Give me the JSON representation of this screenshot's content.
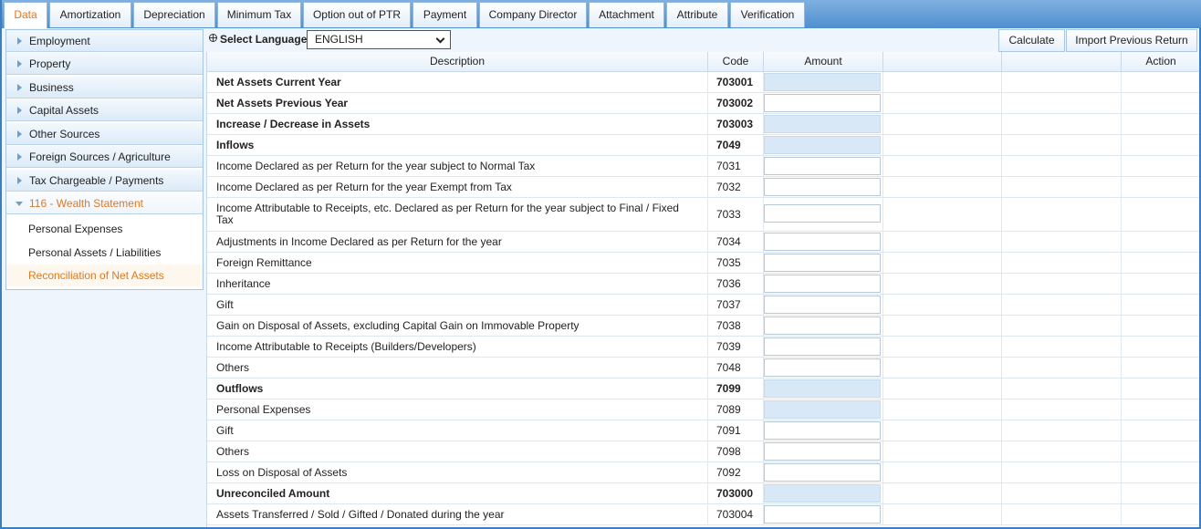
{
  "tabs": [
    {
      "label": "Data",
      "active": true
    },
    {
      "label": "Amortization"
    },
    {
      "label": "Depreciation"
    },
    {
      "label": "Minimum Tax"
    },
    {
      "label": "Option out of PTR"
    },
    {
      "label": "Payment"
    },
    {
      "label": "Company Director"
    },
    {
      "label": "Attachment"
    },
    {
      "label": "Attribute"
    },
    {
      "label": "Verification"
    }
  ],
  "sidebar": {
    "items": [
      {
        "label": "Employment"
      },
      {
        "label": "Property"
      },
      {
        "label": "Business"
      },
      {
        "label": "Capital Assets"
      },
      {
        "label": "Other Sources"
      },
      {
        "label": "Foreign Sources / Agriculture"
      },
      {
        "label": "Tax Chargeable / Payments"
      },
      {
        "label": "116 - Wealth Statement",
        "expanded": true
      }
    ],
    "subitems": [
      {
        "label": "Personal Expenses"
      },
      {
        "label": "Personal Assets / Liabilities"
      },
      {
        "label": "Reconciliation of Net Assets",
        "active": true
      }
    ]
  },
  "toolbar": {
    "language_label": "Select Language",
    "language_value": "ENGLISH",
    "calculate_label": "Calculate",
    "import_label": "Import Previous Return"
  },
  "grid": {
    "headers": {
      "description": "Description",
      "code": "Code",
      "amount": "Amount",
      "action": "Action"
    },
    "rows": [
      {
        "description": "Net Assets Current Year",
        "code": "703001",
        "bold": true,
        "readonly": true
      },
      {
        "description": "Net Assets Previous Year",
        "code": "703002",
        "bold": true,
        "readonly": false
      },
      {
        "description": "Increase / Decrease in Assets",
        "code": "703003",
        "bold": true,
        "readonly": true
      },
      {
        "description": "Inflows",
        "code": "7049",
        "bold": true,
        "readonly": true
      },
      {
        "description": "Income Declared as per Return for the year subject to Normal Tax",
        "code": "7031"
      },
      {
        "description": "Income Declared as per Return for the year Exempt from Tax",
        "code": "7032"
      },
      {
        "description": "Income Attributable to Receipts, etc. Declared as per Return for the year subject to Final / Fixed Tax",
        "code": "7033",
        "tall": true
      },
      {
        "description": "Adjustments in Income Declared as per Return for the year",
        "code": "7034"
      },
      {
        "description": "Foreign Remittance",
        "code": "7035"
      },
      {
        "description": "Inheritance",
        "code": "7036"
      },
      {
        "description": "Gift",
        "code": "7037"
      },
      {
        "description": "Gain on Disposal of Assets, excluding Capital Gain on Immovable Property",
        "code": "7038"
      },
      {
        "description": "Income Attributable to Receipts (Builders/Developers)",
        "code": "7039"
      },
      {
        "description": "Others",
        "code": "7048"
      },
      {
        "description": "Outflows",
        "code": "7099",
        "bold": true,
        "readonly": true
      },
      {
        "description": "Personal Expenses",
        "code": "7089",
        "readonly": true
      },
      {
        "description": "Gift",
        "code": "7091"
      },
      {
        "description": "Others",
        "code": "7098"
      },
      {
        "description": "Loss on Disposal of Assets",
        "code": "7092"
      },
      {
        "description": "Unreconciled Amount",
        "code": "703000",
        "bold": true,
        "readonly": true
      },
      {
        "description": "Assets Transferred / Sold / Gifted / Donated during the year",
        "code": "703004"
      }
    ]
  }
}
